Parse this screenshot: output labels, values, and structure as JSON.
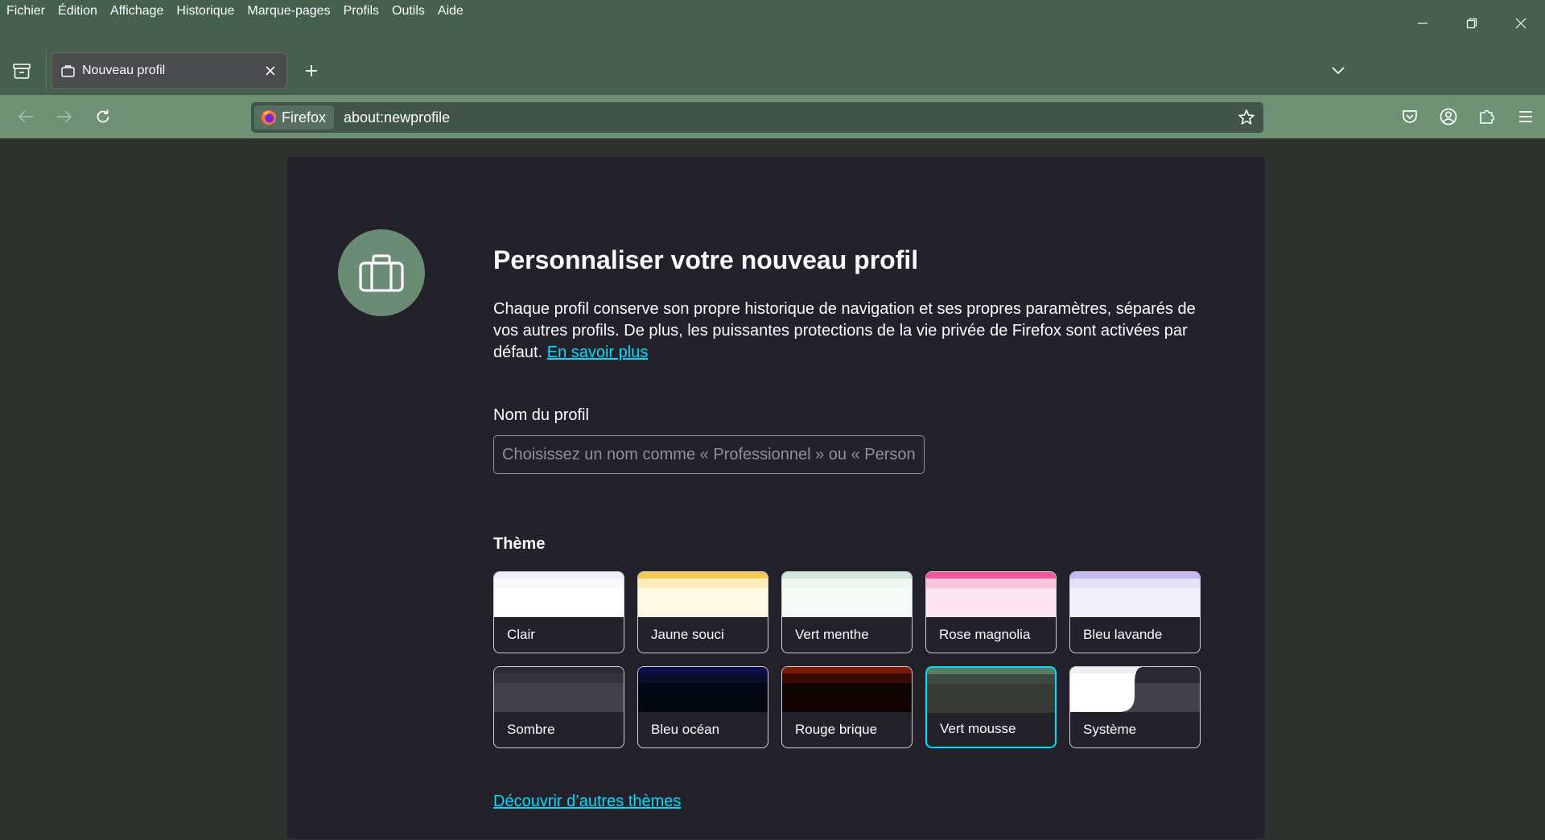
{
  "menubar": {
    "items": [
      "Fichier",
      "Édition",
      "Affichage",
      "Historique",
      "Marque-pages",
      "Profils",
      "Outils",
      "Aide"
    ]
  },
  "tabs": [
    {
      "title": "Nouveau profil",
      "active": true
    }
  ],
  "urlbar": {
    "identity_label": "Firefox",
    "url": "about:newprofile"
  },
  "page": {
    "title": "Personnaliser votre nouveau profil",
    "description": "Chaque profil conserve son propre historique de navigation et ses propres paramètres, séparés de vos autres profils. De plus, les puissantes protections de la vie privée de Firefox sont activées par défaut.",
    "learn_more": "En savoir plus",
    "name_label": "Nom du profil",
    "name_placeholder": "Choisissez un nom comme « Professionnel » ou « Personnel »",
    "theme_label": "Thème",
    "themes": [
      {
        "name": "Clair",
        "colors": [
          "#f0f0f4",
          "#f9f9fb",
          "#ffffff"
        ]
      },
      {
        "name": "Jaune souci",
        "colors": [
          "#f6c94c",
          "#fcecbc",
          "#fef8e4"
        ]
      },
      {
        "name": "Vert menthe",
        "colors": [
          "#cfe8d9",
          "#eef6f0",
          "#f6faf7"
        ]
      },
      {
        "name": "Rose magnolia",
        "colors": [
          "#f4559b",
          "#f8c5da",
          "#fde4ee"
        ]
      },
      {
        "name": "Bleu lavande",
        "colors": [
          "#c6b9ee",
          "#e6e0f8",
          "#f3f0fd"
        ]
      },
      {
        "name": "Sombre",
        "colors": [
          "#2b2a33",
          "#35343c",
          "#43424a"
        ]
      },
      {
        "name": "Bleu océan",
        "colors": [
          "#0b0e4a",
          "#0a0f30",
          "#030913"
        ]
      },
      {
        "name": "Rouge brique",
        "colors": [
          "#7a1a07",
          "#3a0b03",
          "#110302"
        ]
      },
      {
        "name": "Vert mousse",
        "colors": [
          "#5b7b63",
          "#3a4a3e",
          "#373b38"
        ],
        "selected": true
      },
      {
        "name": "Système",
        "colors": [
          "#ffffff",
          "#2b2a33",
          "#43424a"
        ]
      }
    ],
    "more_themes": "Découvrir d’autres thèmes"
  }
}
